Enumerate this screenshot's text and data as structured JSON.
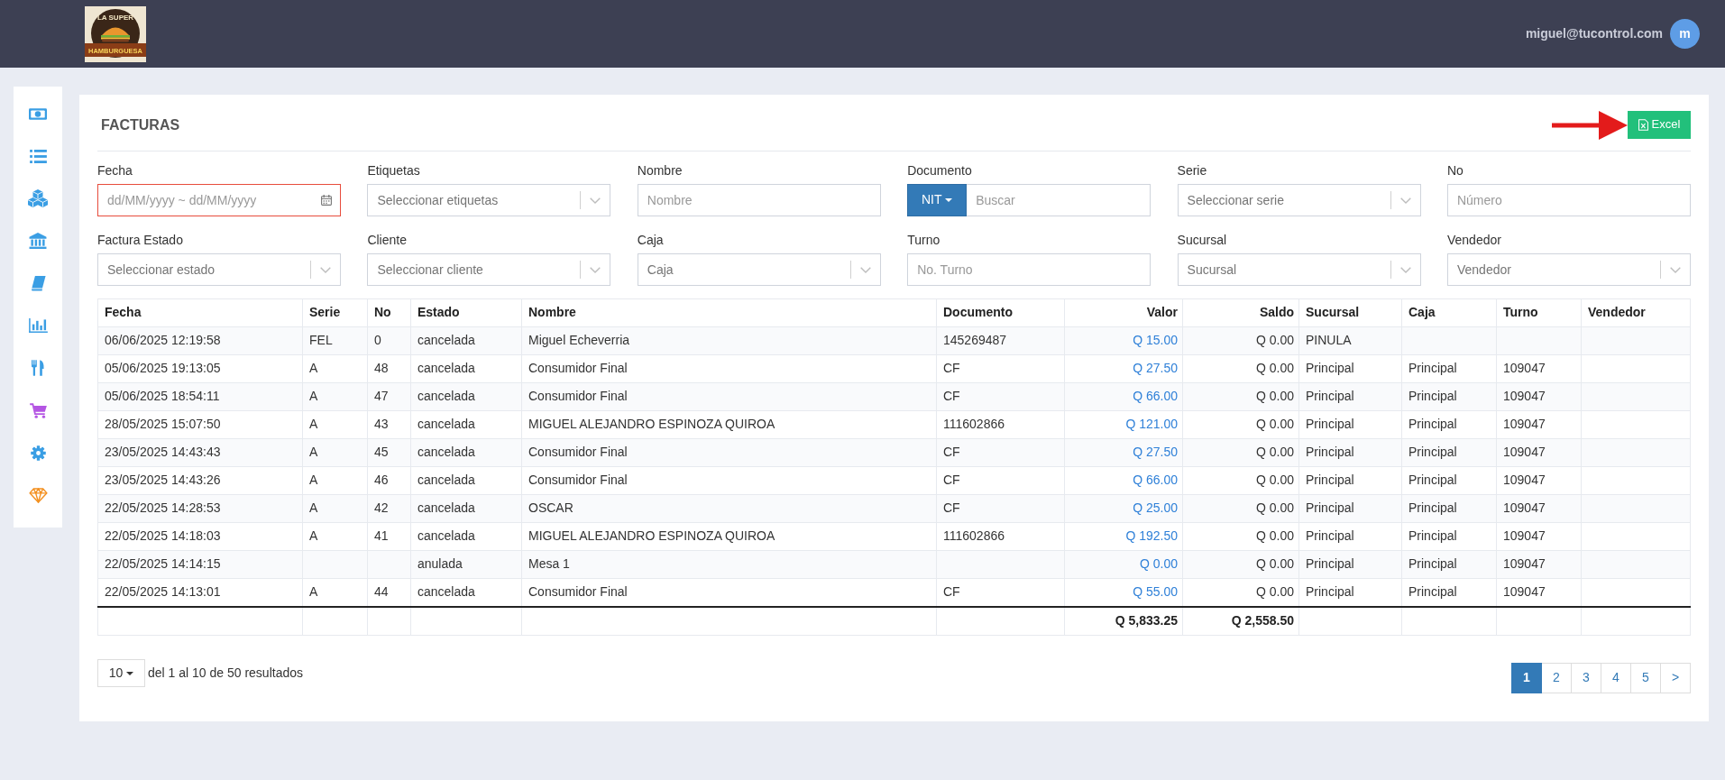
{
  "header": {
    "logo": {
      "tagline": "LA SUPER",
      "name": "HAMBURGUESA"
    },
    "user_email": "miguel@tucontrol.com",
    "avatar": "m"
  },
  "sidebar": [
    {
      "color": "#3a9ee4"
    },
    {
      "color": "#3a9ee4"
    },
    {
      "color": "#3a9ee4"
    },
    {
      "color": "#3a9ee4"
    },
    {
      "color": "#3a9ee4"
    },
    {
      "color": "#3a9ee4"
    },
    {
      "color": "#3a9ee4"
    },
    {
      "color": "#b455e3"
    },
    {
      "color": "#3a9ee4"
    },
    {
      "color": "#f39020"
    }
  ],
  "page": {
    "title": "FACTURAS",
    "export_button": "Excel"
  },
  "filters": [
    {
      "label": "Fecha",
      "kind": "date",
      "placeholder": "dd/MM/yyyy ~ dd/MM/yyyy",
      "error": true
    },
    {
      "label": "Etiquetas",
      "kind": "select",
      "placeholder": "Seleccionar etiquetas",
      "error": false
    },
    {
      "label": "Nombre",
      "kind": "text",
      "placeholder": "Nombre",
      "error": false
    },
    {
      "label": "Documento",
      "kind": "document",
      "button": "NIT",
      "placeholder": "Buscar",
      "error": false
    },
    {
      "label": "Serie",
      "kind": "select",
      "placeholder": "Seleccionar serie",
      "error": false
    },
    {
      "label": "No",
      "kind": "text",
      "placeholder": "Número",
      "error": false
    },
    {
      "label": "Factura Estado",
      "kind": "select",
      "placeholder": "Seleccionar estado",
      "error": false
    },
    {
      "label": "Cliente",
      "kind": "select",
      "placeholder": "Seleccionar cliente",
      "error": false
    },
    {
      "label": "Caja",
      "kind": "select",
      "placeholder": "Caja",
      "error": false
    },
    {
      "label": "Turno",
      "kind": "text",
      "placeholder": "No. Turno",
      "error": false
    },
    {
      "label": "Sucursal",
      "kind": "select",
      "placeholder": "Sucursal",
      "error": false
    },
    {
      "label": "Vendedor",
      "kind": "select",
      "placeholder": "Vendedor",
      "error": false
    }
  ],
  "table": {
    "columns": [
      {
        "label": "Fecha",
        "kind": "text"
      },
      {
        "label": "Serie",
        "kind": "text"
      },
      {
        "label": "No",
        "kind": "text"
      },
      {
        "label": "Estado",
        "kind": "text"
      },
      {
        "label": "Nombre",
        "kind": "text"
      },
      {
        "label": "Documento",
        "kind": "text"
      },
      {
        "label": "Valor",
        "kind": "link",
        "total": "Q 5,833.25"
      },
      {
        "label": "Saldo",
        "kind": "amount",
        "total": "Q 2,558.50"
      },
      {
        "label": "Sucursal",
        "kind": "text"
      },
      {
        "label": "Caja",
        "kind": "text"
      },
      {
        "label": "Turno",
        "kind": "text"
      },
      {
        "label": "Vendedor",
        "kind": "text"
      }
    ],
    "rows": [
      [
        "06/06/2025 12:19:58",
        "FEL",
        "0",
        "cancelada",
        "Miguel Echeverria",
        "145269487",
        "Q 15.00",
        "Q 0.00",
        "PINULA",
        null,
        null,
        null
      ],
      [
        "05/06/2025 19:13:05",
        "A",
        "48",
        "cancelada",
        "Consumidor Final",
        "CF",
        "Q 27.50",
        "Q 0.00",
        "Principal",
        "Principal",
        "109047",
        null
      ],
      [
        "05/06/2025 18:54:11",
        "A",
        "47",
        "cancelada",
        "Consumidor Final",
        "CF",
        "Q 66.00",
        "Q 0.00",
        "Principal",
        "Principal",
        "109047",
        null
      ],
      [
        "28/05/2025 15:07:50",
        "A",
        "43",
        "cancelada",
        "MIGUEL ALEJANDRO ESPINOZA QUIROA",
        "111602866",
        "Q 121.00",
        "Q 0.00",
        "Principal",
        "Principal",
        "109047",
        null
      ],
      [
        "23/05/2025 14:43:43",
        "A",
        "45",
        "cancelada",
        "Consumidor Final",
        "CF",
        "Q 27.50",
        "Q 0.00",
        "Principal",
        "Principal",
        "109047",
        null
      ],
      [
        "23/05/2025 14:43:26",
        "A",
        "46",
        "cancelada",
        "Consumidor Final",
        "CF",
        "Q 66.00",
        "Q 0.00",
        "Principal",
        "Principal",
        "109047",
        null
      ],
      [
        "22/05/2025 14:28:53",
        "A",
        "42",
        "cancelada",
        "OSCAR",
        "CF",
        "Q 25.00",
        "Q 0.00",
        "Principal",
        "Principal",
        "109047",
        null
      ],
      [
        "22/05/2025 14:18:03",
        "A",
        "41",
        "cancelada",
        "MIGUEL ALEJANDRO ESPINOZA QUIROA",
        "111602866",
        "Q 192.50",
        "Q 0.00",
        "Principal",
        "Principal",
        "109047",
        null
      ],
      [
        "22/05/2025 14:14:15",
        null,
        null,
        "anulada",
        "Mesa 1",
        null,
        "Q 0.00",
        "Q 0.00",
        "Principal",
        "Principal",
        "109047",
        null
      ],
      [
        "22/05/2025 14:13:01",
        "A",
        "44",
        "cancelada",
        "Consumidor Final",
        "CF",
        "Q 55.00",
        "Q 0.00",
        "Principal",
        "Principal",
        "109047",
        null
      ]
    ]
  },
  "footer": {
    "page_size": "10",
    "summary": "del 1 al 10 de 50 resultados",
    "pages": [
      {
        "label": "1",
        "selected": true
      },
      {
        "label": "2",
        "selected": false
      },
      {
        "label": "3",
        "selected": false
      },
      {
        "label": "4",
        "selected": false
      },
      {
        "label": "5",
        "selected": false
      },
      {
        "label": ">",
        "selected": false
      }
    ]
  }
}
